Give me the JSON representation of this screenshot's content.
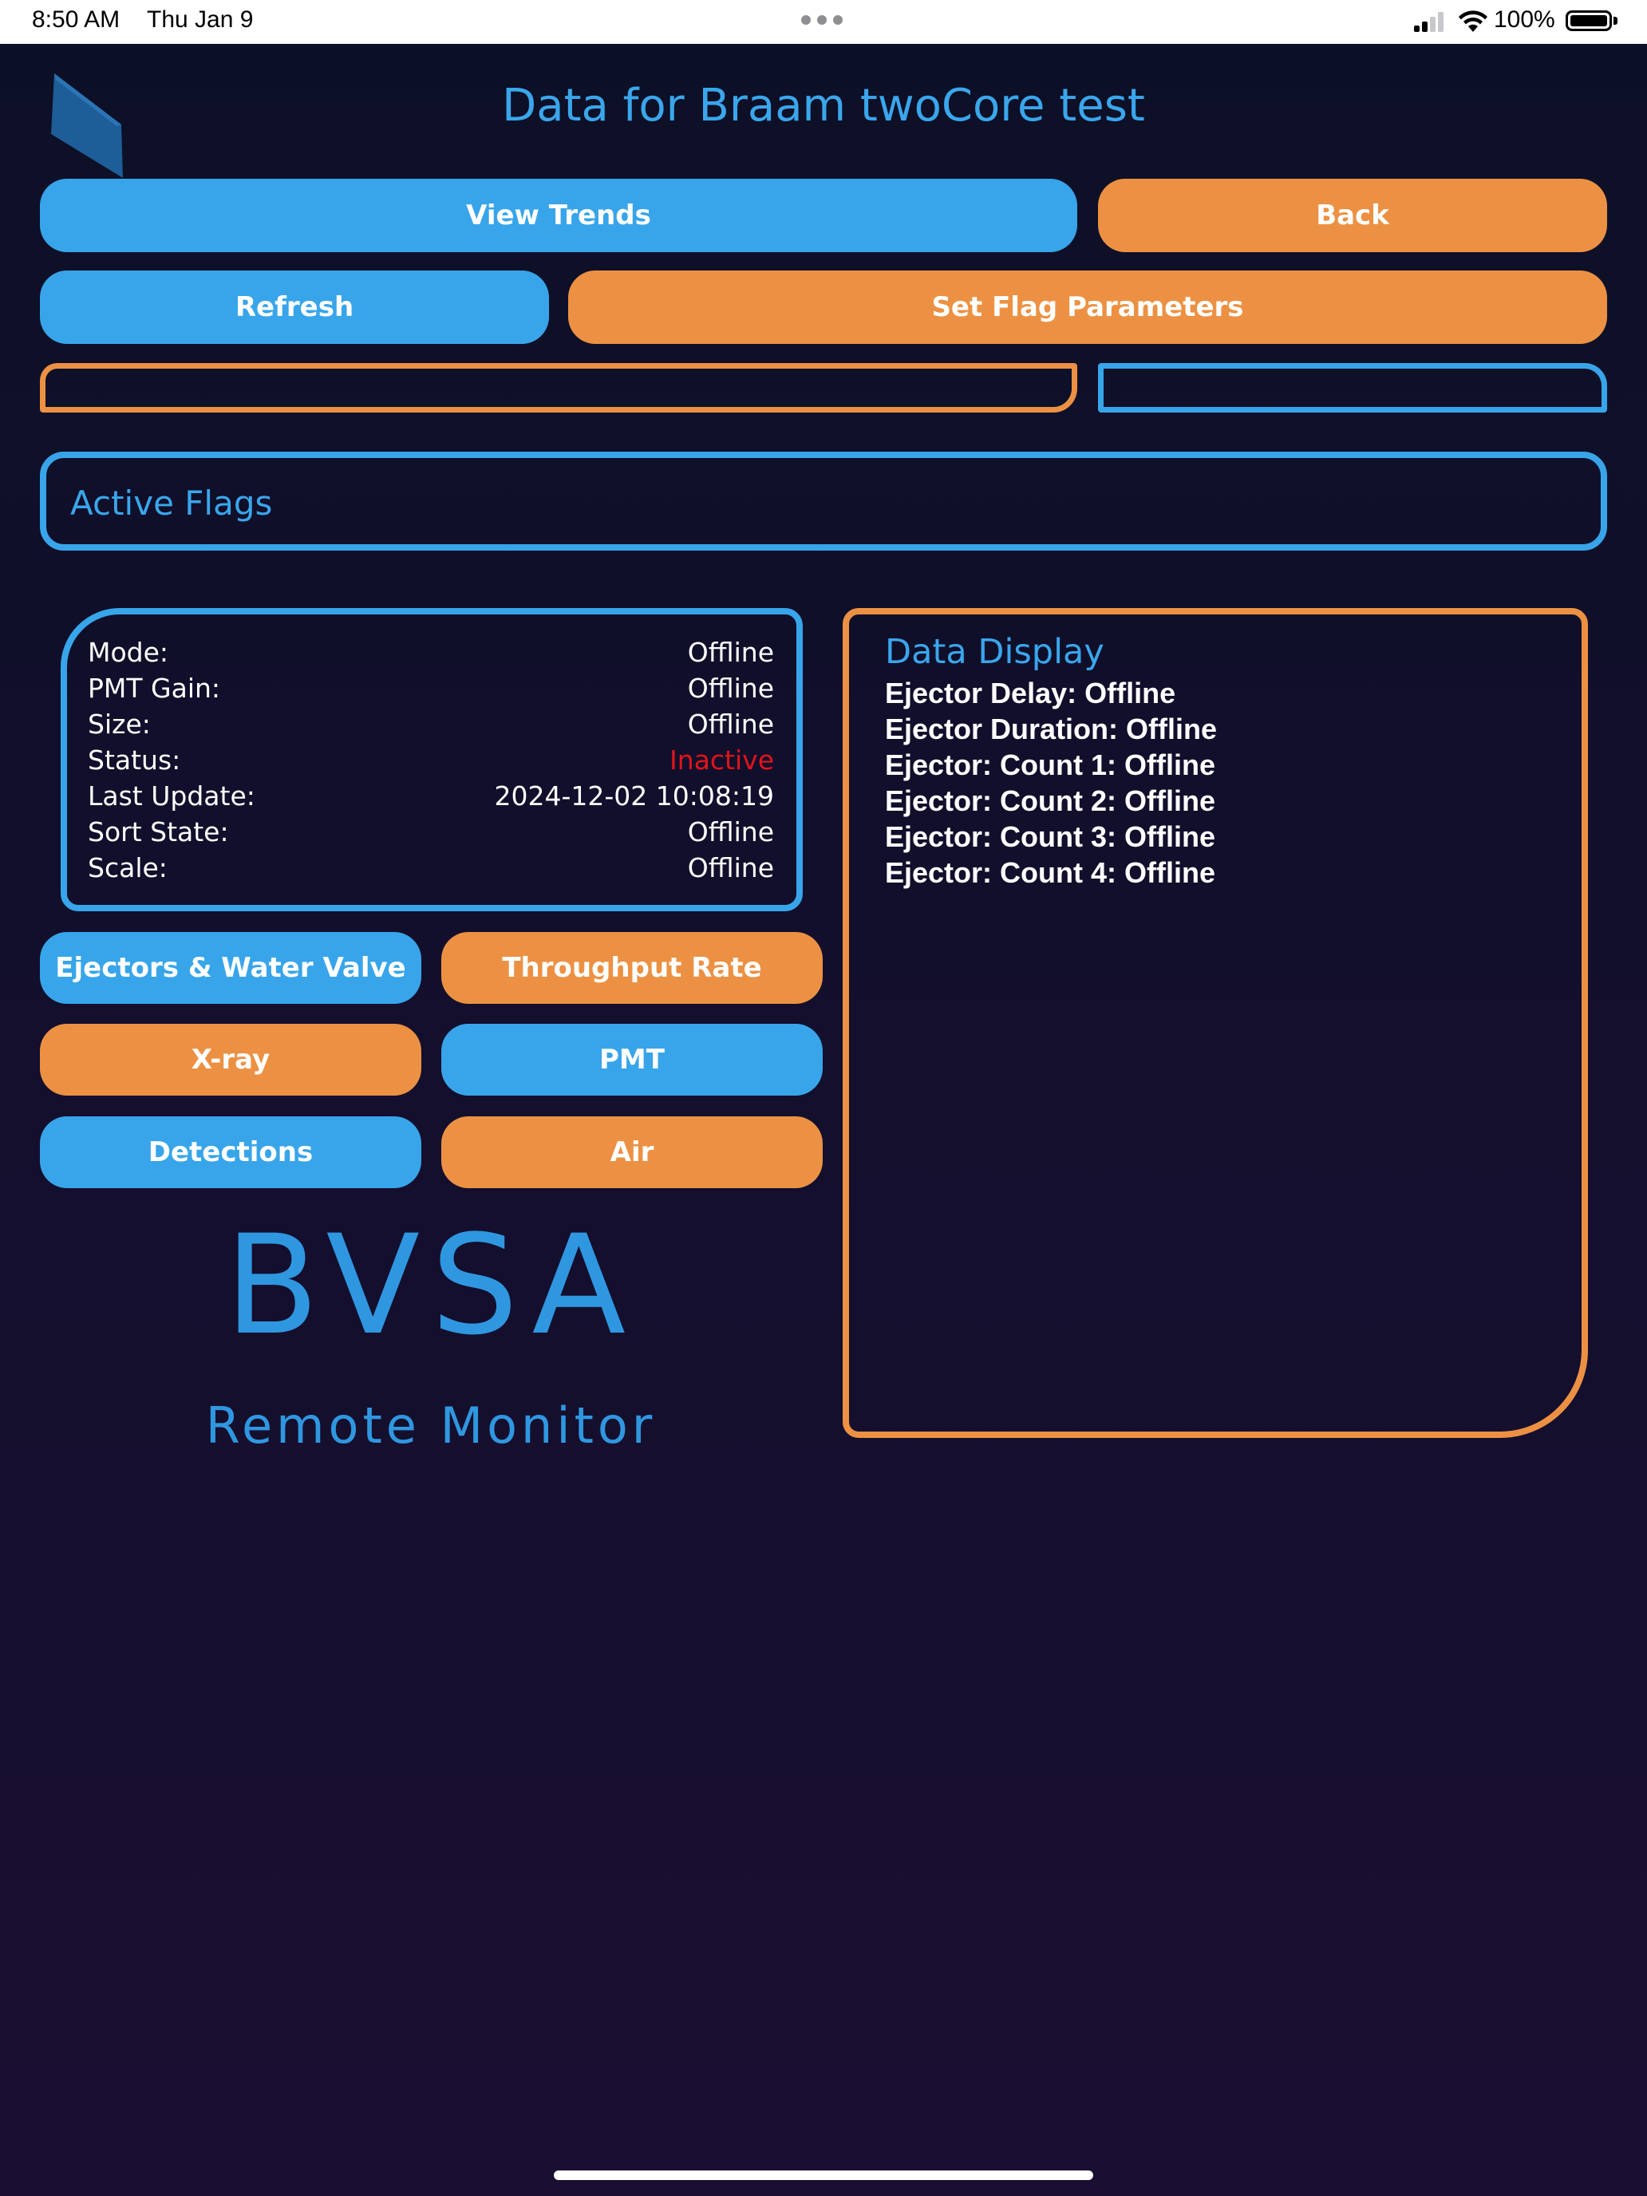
{
  "status_bar": {
    "time": "8:50 AM",
    "date": "Thu Jan 9",
    "battery": "100%"
  },
  "header": {
    "title": "Data for Braam twoCore test"
  },
  "buttons": {
    "view_trends": "View Trends",
    "back": "Back",
    "refresh": "Refresh",
    "set_flag_parameters": "Set Flag Parameters",
    "ejectors_water_valve": "Ejectors & Water Valve",
    "throughput_rate": "Throughput Rate",
    "xray": "X-ray",
    "pmt": "PMT",
    "detections": "Detections",
    "air": "Air"
  },
  "active_flags": {
    "label": "Active Flags"
  },
  "info": {
    "rows": [
      {
        "label": "Mode:",
        "value": "Offline"
      },
      {
        "label": "PMT Gain:",
        "value": "Offline"
      },
      {
        "label": "Size:",
        "value": "Offline"
      },
      {
        "label": "Status:",
        "value": "Inactive"
      },
      {
        "label": "Last Update:",
        "value": "2024-12-02 10:08:19"
      },
      {
        "label": "Sort State:",
        "value": "Offline"
      },
      {
        "label": "Scale:",
        "value": "Offline"
      }
    ]
  },
  "data_display": {
    "title": "Data Display",
    "lines": [
      "Ejector Delay: Offline",
      "Ejector Duration: Offline",
      "Ejector: Count 1: Offline",
      "Ejector: Count 2: Offline",
      "Ejector: Count 3: Offline",
      "Ejector: Count 4: Offline"
    ]
  },
  "branding": {
    "logo_text": "BVSA",
    "tagline": "Remote Monitor"
  },
  "colors": {
    "accent_blue": "#38a5ea",
    "accent_orange": "#ec9143",
    "status_inactive": "#e0141a",
    "background": "#120f2c"
  }
}
